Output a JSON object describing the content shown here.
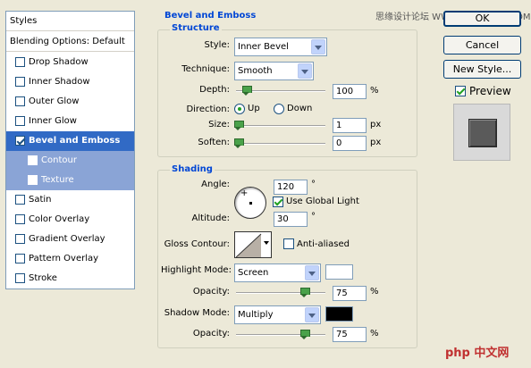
{
  "watermark_top": "思缘设计论坛  WWW.MISSYUAN.COM",
  "watermark_bottom": "php 中文网",
  "styles_panel": {
    "title": "Styles",
    "blending": "Blending Options: Default",
    "items": [
      {
        "label": "Drop Shadow",
        "checked": false,
        "state": "normal"
      },
      {
        "label": "Inner Shadow",
        "checked": false,
        "state": "normal"
      },
      {
        "label": "Outer Glow",
        "checked": false,
        "state": "normal"
      },
      {
        "label": "Inner Glow",
        "checked": false,
        "state": "normal"
      },
      {
        "label": "Bevel and Emboss",
        "checked": true,
        "state": "selected"
      },
      {
        "label": "Contour",
        "checked": false,
        "state": "sub"
      },
      {
        "label": "Texture",
        "checked": false,
        "state": "sub"
      },
      {
        "label": "Satin",
        "checked": false,
        "state": "normal"
      },
      {
        "label": "Color Overlay",
        "checked": false,
        "state": "normal"
      },
      {
        "label": "Gradient Overlay",
        "checked": false,
        "state": "normal"
      },
      {
        "label": "Pattern Overlay",
        "checked": false,
        "state": "normal"
      },
      {
        "label": "Stroke",
        "checked": false,
        "state": "normal"
      }
    ]
  },
  "bevel": {
    "section_title": "Bevel and Emboss",
    "structure_title": "Structure",
    "style_label": "Style:",
    "style_value": "Inner Bevel",
    "technique_label": "Technique:",
    "technique_value": "Smooth",
    "depth_label": "Depth:",
    "depth_value": "100",
    "depth_unit": "%",
    "direction_label": "Direction:",
    "direction_up": "Up",
    "direction_down": "Down",
    "direction_selected": "Up",
    "size_label": "Size:",
    "size_value": "1",
    "size_unit": "px",
    "soften_label": "Soften:",
    "soften_value": "0",
    "soften_unit": "px"
  },
  "shading": {
    "title": "Shading",
    "angle_label": "Angle:",
    "angle_value": "120",
    "angle_unit": "°",
    "global_light_label": "Use Global Light",
    "global_light_checked": true,
    "altitude_label": "Altitude:",
    "altitude_value": "30",
    "altitude_unit": "°",
    "gloss_label": "Gloss Contour:",
    "anti_aliased_label": "Anti-aliased",
    "anti_aliased_checked": false,
    "highlight_mode_label": "Highlight Mode:",
    "highlight_mode_value": "Screen",
    "highlight_color": "#ffffff",
    "highlight_opacity_label": "Opacity:",
    "highlight_opacity_value": "75",
    "highlight_opacity_unit": "%",
    "shadow_mode_label": "Shadow Mode:",
    "shadow_mode_value": "Multiply",
    "shadow_color": "#000000",
    "shadow_opacity_label": "Opacity:",
    "shadow_opacity_value": "75",
    "shadow_opacity_unit": "%"
  },
  "buttons": {
    "ok": "OK",
    "cancel": "Cancel",
    "new_style": "New Style..."
  },
  "preview": {
    "label": "Preview",
    "checked": true
  }
}
